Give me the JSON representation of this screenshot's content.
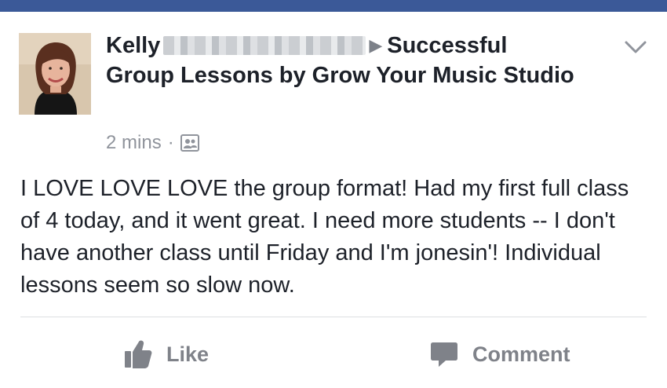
{
  "colors": {
    "top_bar": "#3b5998",
    "text_primary": "#1d2129",
    "text_secondary": "#90949c",
    "action_text": "#7f8289",
    "divider": "#dddfe2"
  },
  "post": {
    "author_first": "Kelly",
    "author_rest_redacted": true,
    "arrow": "▶",
    "target_group": "Successful Group Lessons by Grow Your Music Studio",
    "timestamp": "2 mins",
    "separator": "·",
    "audience_icon": "group-audience-icon",
    "body": "I LOVE LOVE LOVE the group format! Had my first full class of 4 today, and it went great. I need more students -- I don't have another class until Friday and I'm jonesin'! Individual lessons seem so slow now.",
    "menu_icon": "chevron-down-icon"
  },
  "actions": {
    "like_label": "Like",
    "comment_label": "Comment"
  }
}
